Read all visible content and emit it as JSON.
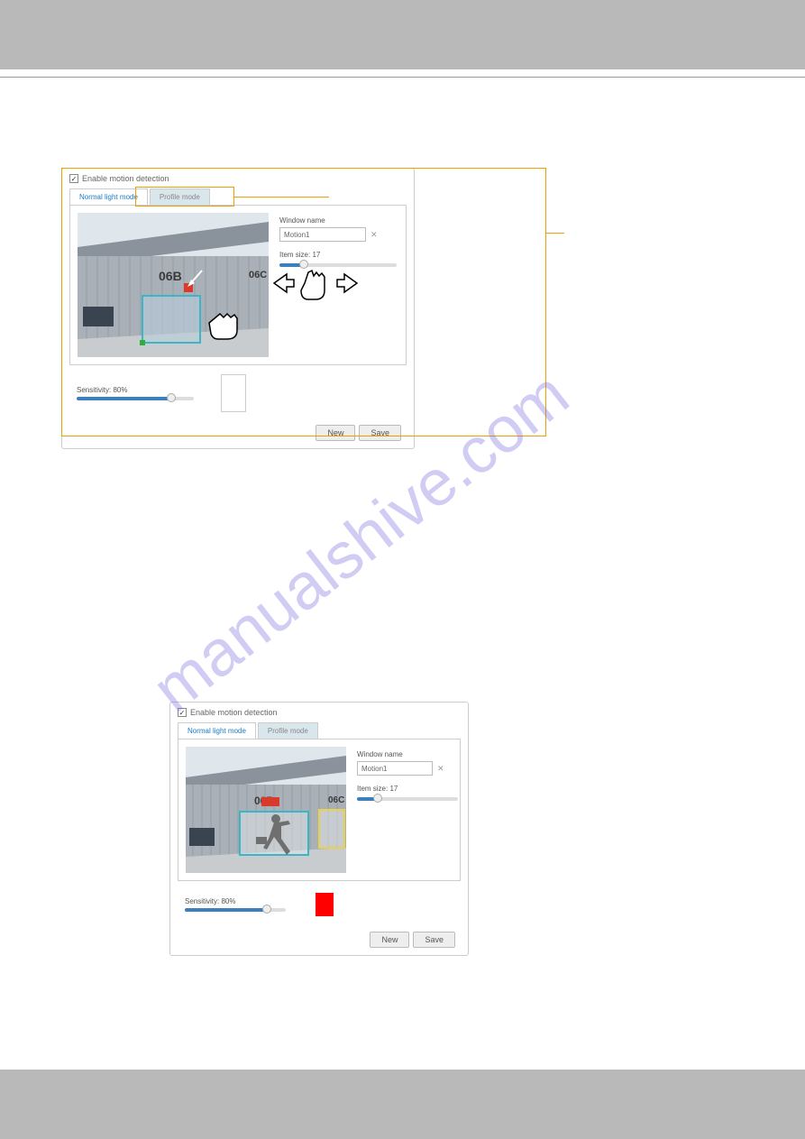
{
  "panel1": {
    "enable_label": "Enable motion detection",
    "enable_checked": true,
    "tabs": {
      "normal": "Normal light mode",
      "profile": "Profile mode"
    },
    "window_name_label": "Window name",
    "window_name_value": "Motion1",
    "item_size_label": "Item size: 17",
    "sensitivity_label": "Sensitivity: 80%",
    "buttons": {
      "new": "New",
      "save": "Save"
    },
    "building": {
      "left_sign": "06B",
      "right_sign": "06C"
    }
  },
  "panel2": {
    "enable_label": "Enable motion detection",
    "enable_checked": true,
    "tabs": {
      "normal": "Normal light mode",
      "profile": "Profile mode"
    },
    "window_name_label": "Window name",
    "window_name_value": "Motion1",
    "item_size_label": "Item size: 17",
    "sensitivity_label": "Sensitivity: 80%",
    "buttons": {
      "new": "New",
      "save": "Save"
    },
    "building": {
      "left_sign": "06B",
      "right_sign": "06C"
    }
  },
  "watermark": "manualshive.com"
}
